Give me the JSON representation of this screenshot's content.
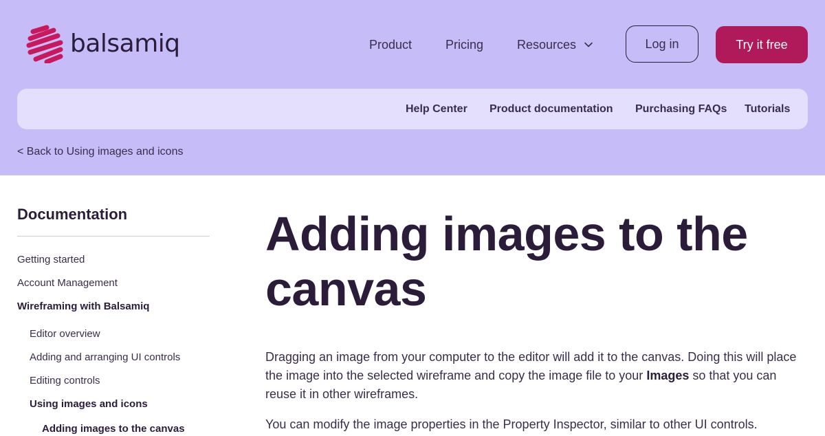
{
  "header": {
    "logo_text": "balsamiq",
    "nav": {
      "product": "Product",
      "pricing": "Pricing",
      "resources": "Resources"
    },
    "login_label": "Log in",
    "try_label": "Try it free"
  },
  "subnav": {
    "items": [
      "Help Center",
      "Product documentation",
      "Purchasing FAQs",
      "Tutorials"
    ]
  },
  "back_link": "< Back to Using images and icons",
  "sidebar": {
    "title": "Documentation",
    "items": [
      "Getting started",
      "Account Management",
      "Wireframing with Balsamiq",
      "Editor overview",
      "Adding and arranging UI controls",
      "Editing controls",
      "Using images and icons",
      "Adding images to the canvas"
    ]
  },
  "article": {
    "title": "Adding images to the canvas",
    "p1_before": "Dragging an image from your computer to the editor will add it to the canvas. Doing this will place the image into the selected wireframe and copy the image file to your ",
    "p1_bold": "Images",
    "p1_after": " so that you can reuse it in other wireframes.",
    "p2": "You can modify the image properties in the Property Inspector, similar to other UI controls."
  },
  "colors": {
    "hero_bg": "#c6bcf8",
    "subnav_bg": "#e3dffd",
    "accent": "#b0195a",
    "text": "#2b1d3a"
  }
}
